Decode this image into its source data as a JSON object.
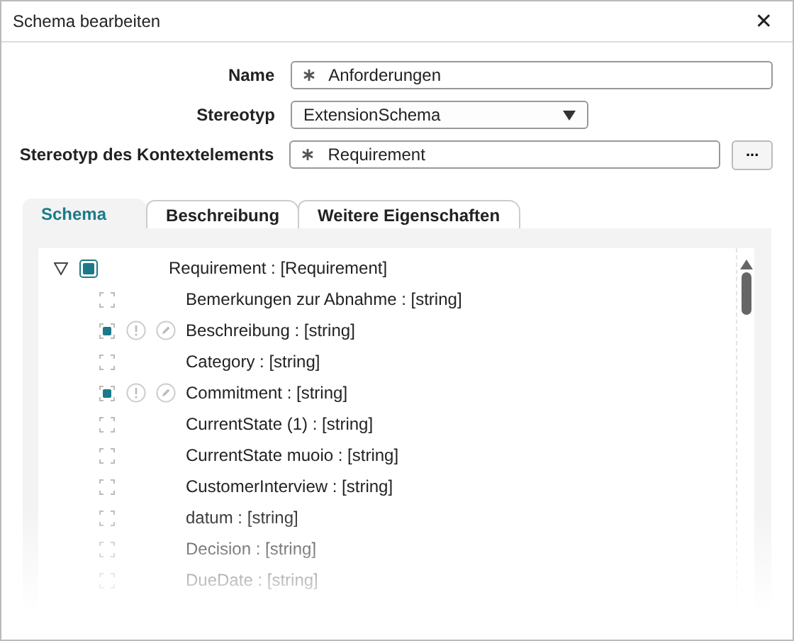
{
  "window": {
    "title": "Schema bearbeiten",
    "close": "✕"
  },
  "form": {
    "name": {
      "label": "Name",
      "value": "Anforderungen",
      "required": true
    },
    "stereotype": {
      "label": "Stereotyp",
      "value": "ExtensionSchema"
    },
    "context": {
      "label": "Stereotyp des Kontextelements",
      "value": "Requirement",
      "required": true,
      "button": "..."
    }
  },
  "tabs": [
    {
      "label": "Schema",
      "selected": true
    },
    {
      "label": "Beschreibung",
      "selected": false
    },
    {
      "label": "Weitere Eigenschaften",
      "selected": false
    }
  ],
  "tree": {
    "label": "Requirement : [Requirement]",
    "expanded": true,
    "checked": true,
    "children": [
      {
        "label": "Bemerkungen zur Abnahme : [string]",
        "checked": false
      },
      {
        "label": "Beschreibung : [string]",
        "checked": true
      },
      {
        "label": "Category : [string]",
        "checked": false
      },
      {
        "label": "Commitment : [string]",
        "checked": true
      },
      {
        "label": "CurrentState (1) : [string]",
        "checked": false
      },
      {
        "label": "CurrentState muoio : [string]",
        "checked": false
      },
      {
        "label": "CustomerInterview : [string]",
        "checked": false
      },
      {
        "label": "datum : [string]",
        "checked": false
      },
      {
        "label": "Decision : [string]",
        "checked": false
      },
      {
        "label": "DueDate : [string]",
        "checked": false
      }
    ]
  }
}
